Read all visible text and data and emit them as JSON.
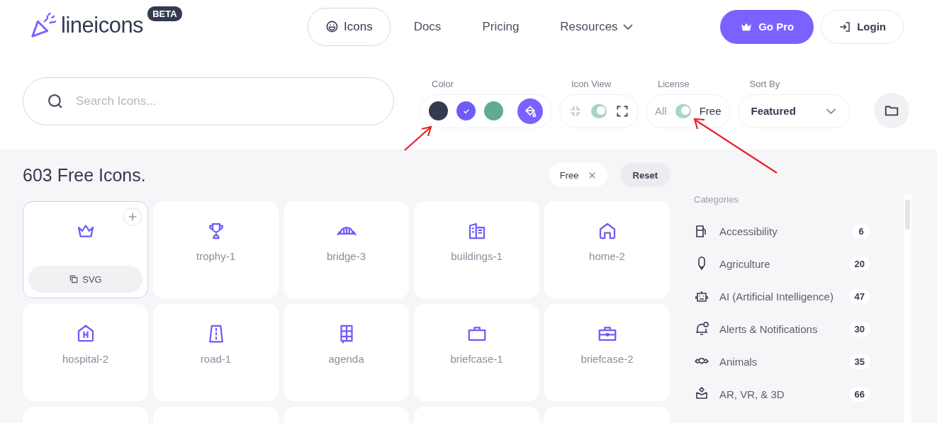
{
  "brand": {
    "name": "lineicons",
    "badge": "BETA"
  },
  "nav": [
    {
      "label": "Icons",
      "selected": true,
      "kind": "icon"
    },
    {
      "label": "Docs",
      "selected": false,
      "kind": "plain"
    },
    {
      "label": "Pricing",
      "selected": false,
      "kind": "plain"
    },
    {
      "label": "Resources",
      "selected": false,
      "kind": "menu"
    }
  ],
  "actions": {
    "pro": "Go Pro",
    "login": "Login"
  },
  "search": {
    "placeholder": "Search Icons..."
  },
  "filters": {
    "color": {
      "label": "Color",
      "swatches": [
        {
          "color": "#343a50",
          "selected": false
        },
        {
          "color": "#6d5cf6",
          "selected": true
        },
        {
          "color": "#62ab93",
          "selected": false
        }
      ]
    },
    "view": {
      "label": "Icon View",
      "on": true
    },
    "license": {
      "label": "License",
      "off_label": "All",
      "on_label": "Free",
      "on": true
    },
    "sort": {
      "label": "Sort By",
      "value": "Featured"
    }
  },
  "results": {
    "title": "603 Free Icons.",
    "chip": "Free",
    "reset": "Reset"
  },
  "cards": [
    {
      "selected": true,
      "action": "SVG"
    },
    {
      "name": "trophy-1",
      "selected": false
    },
    {
      "name": "bridge-3",
      "selected": false
    },
    {
      "name": "buildings-1",
      "selected": false
    },
    {
      "name": "home-2",
      "selected": false
    },
    {
      "name": "hospital-2",
      "selected": false
    },
    {
      "name": "road-1",
      "selected": false
    },
    {
      "name": "agenda",
      "selected": false
    },
    {
      "name": "briefcase-1",
      "selected": false
    },
    {
      "name": "briefcase-2",
      "selected": false
    }
  ],
  "categories": {
    "title": "Categories",
    "items": [
      {
        "label": "Accessibility",
        "count": "6"
      },
      {
        "label": "Agriculture",
        "count": "20"
      },
      {
        "label": "AI (Artificial Intelligence)",
        "count": "47"
      },
      {
        "label": "Alerts & Notifications",
        "count": "30"
      },
      {
        "label": "Animals",
        "count": "35"
      },
      {
        "label": "AR, VR, & 3D",
        "count": "66"
      }
    ]
  }
}
